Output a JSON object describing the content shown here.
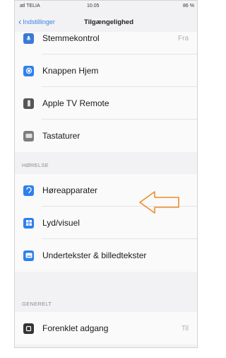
{
  "status_bar": {
    "carrier": "atl TELIA",
    "time": "10.05",
    "battery": "86 %"
  },
  "nav": {
    "back_label": "Indstillinger",
    "title": "Tilgængelighed"
  },
  "section_top": {
    "items": [
      {
        "label": "Stemmekontrol",
        "value": "Fra",
        "icon": "microphone-icon",
        "color": "#3a7bd5"
      },
      {
        "label": "Knappen Hjem",
        "value": "",
        "icon": "home-button-icon",
        "color": "#2f80ed"
      },
      {
        "label": "Apple TV Remote",
        "value": "",
        "icon": "remote-icon",
        "color": "#555555"
      },
      {
        "label": "Tastaturer",
        "value": "",
        "icon": "keyboard-icon",
        "color": "#7d7d7d"
      }
    ]
  },
  "section_hearing": {
    "header": "HØRELSE",
    "items": [
      {
        "label": "Høreapparater",
        "value": "",
        "icon": "ear-icon",
        "color": "#2f80ed"
      },
      {
        "label": "Lyd/visuel",
        "value": "",
        "icon": "audio-visual-icon",
        "color": "#2f80ed"
      },
      {
        "label": "Undertekster & billedtekster",
        "value": "",
        "icon": "subtitles-icon",
        "color": "#2f80ed"
      }
    ]
  },
  "section_general": {
    "header": "GENERELT",
    "items": [
      {
        "label": "Forenklet adgang",
        "value": "Til",
        "icon": "guided-access-icon",
        "color": "#333333"
      }
    ]
  },
  "annotation": {
    "icon": "outline-arrow-left-icon",
    "color": "#f08c28"
  }
}
